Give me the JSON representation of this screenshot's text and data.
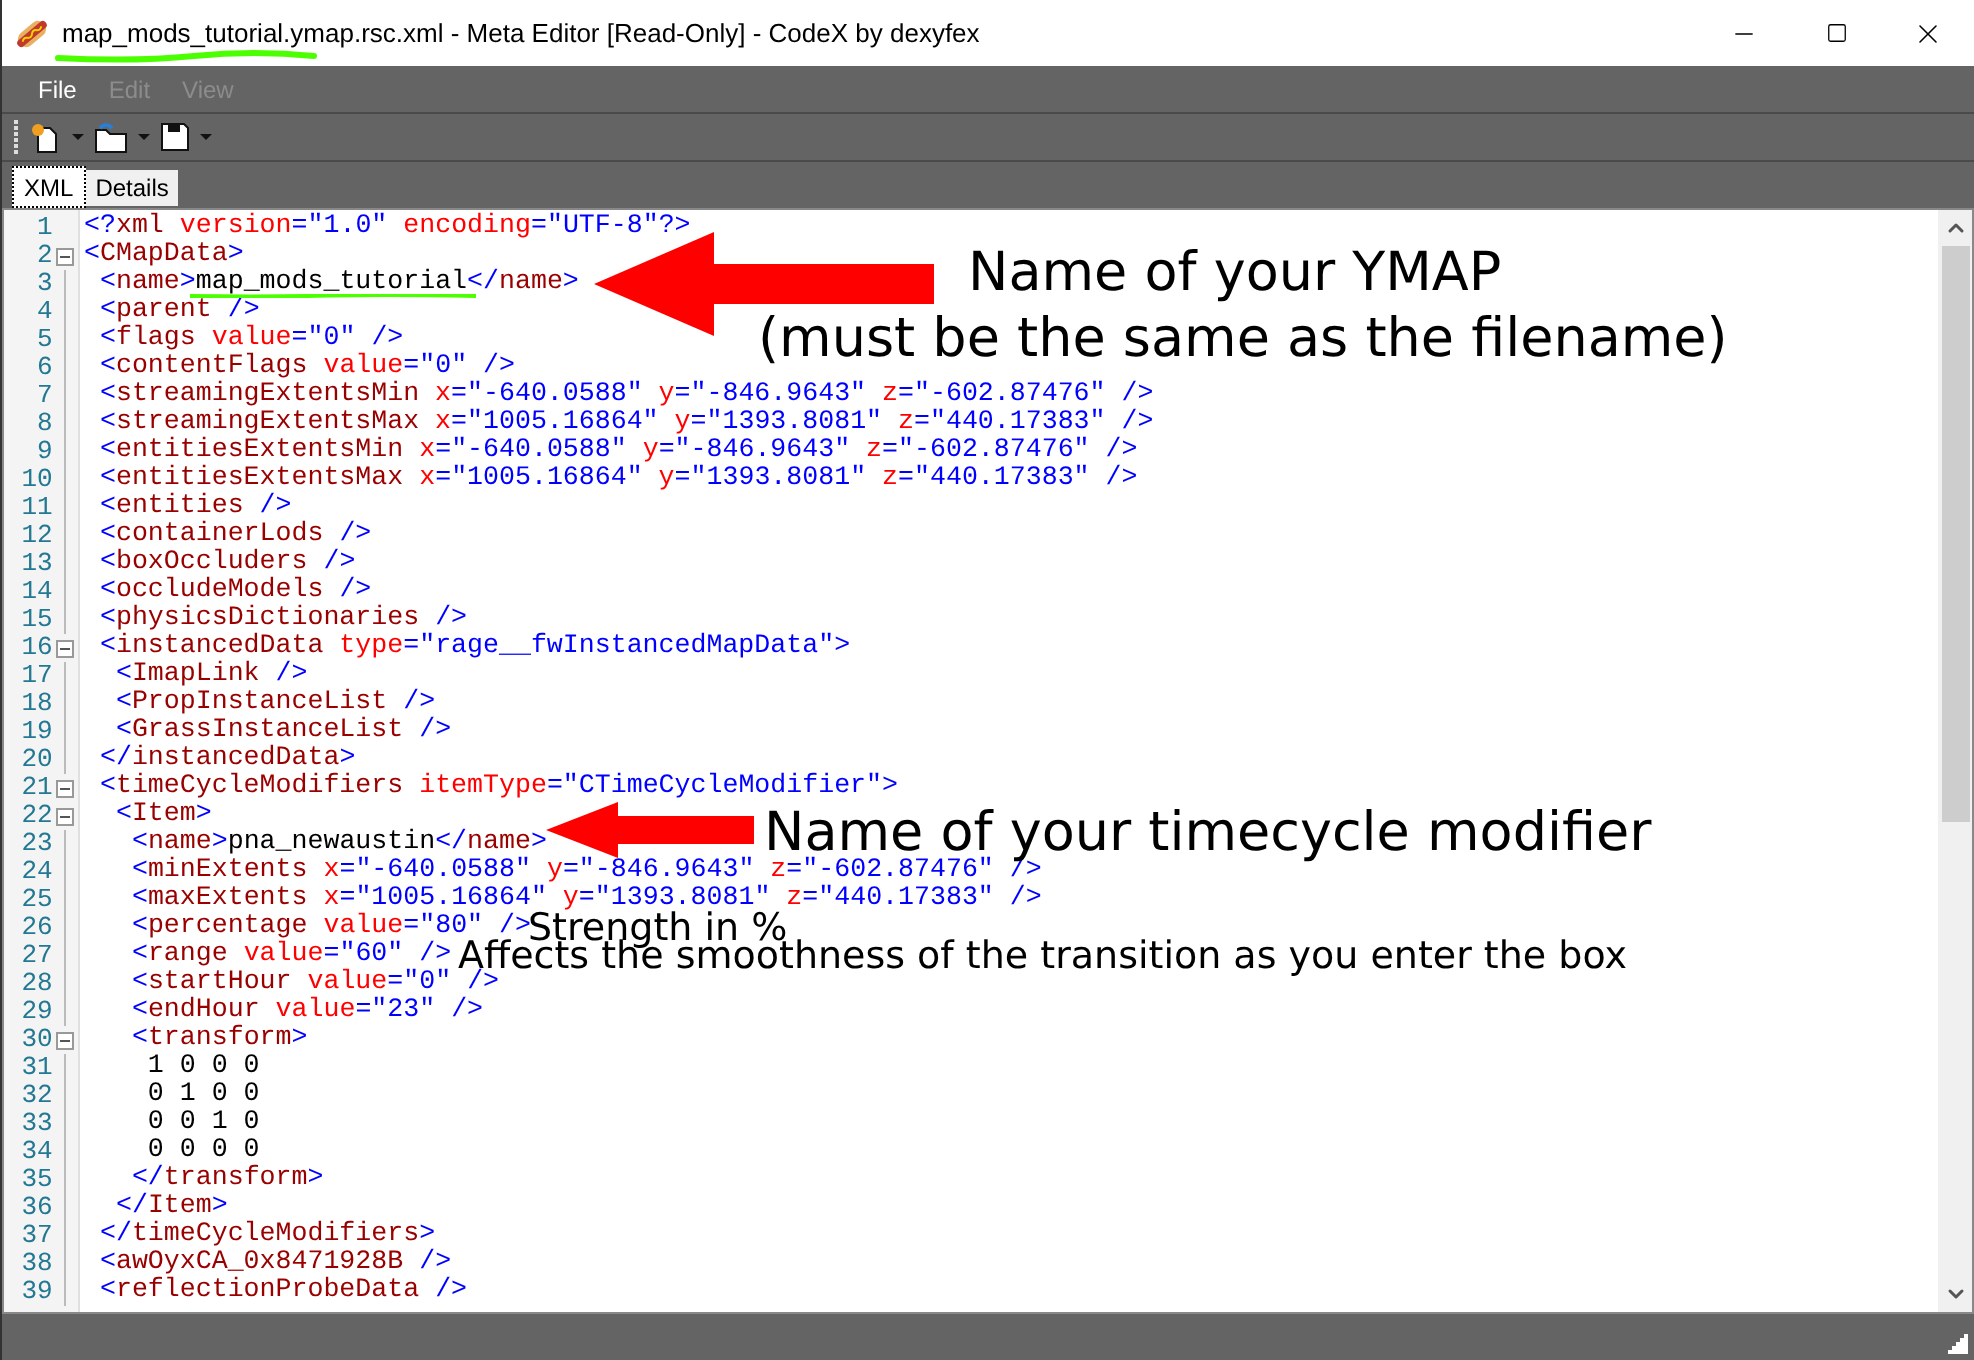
{
  "window": {
    "title": "map_mods_tutorial.ymap.rsc.xml - Meta Editor [Read-Only] - CodeX by dexyfex"
  },
  "menu": [
    {
      "label": "File",
      "disabled": false
    },
    {
      "label": "Edit",
      "disabled": true
    },
    {
      "label": "View",
      "disabled": true
    }
  ],
  "tabs": [
    {
      "label": "XML",
      "selected": true
    },
    {
      "label": "Details",
      "selected": false
    }
  ],
  "editor": {
    "lines": [
      {
        "number": "1",
        "text": "<?xml version=\"1.0\" encoding=\"UTF-8\"?>",
        "fold": false
      },
      {
        "number": "2",
        "text": "<CMapData>",
        "fold": true
      },
      {
        "number": "3",
        "text": " <name>map_mods_tutorial</name>",
        "fold": false
      },
      {
        "number": "4",
        "text": " <parent />",
        "fold": false
      },
      {
        "number": "5",
        "text": " <flags value=\"0\" />",
        "fold": false
      },
      {
        "number": "6",
        "text": " <contentFlags value=\"0\" />",
        "fold": false
      },
      {
        "number": "7",
        "text": " <streamingExtentsMin x=\"-640.0588\" y=\"-846.9643\" z=\"-602.87476\" />",
        "fold": false
      },
      {
        "number": "8",
        "text": " <streamingExtentsMax x=\"1005.16864\" y=\"1393.8081\" z=\"440.17383\" />",
        "fold": false
      },
      {
        "number": "9",
        "text": " <entitiesExtentsMin x=\"-640.0588\" y=\"-846.9643\" z=\"-602.87476\" />",
        "fold": false
      },
      {
        "number": "10",
        "text": " <entitiesExtentsMax x=\"1005.16864\" y=\"1393.8081\" z=\"440.17383\" />",
        "fold": false
      },
      {
        "number": "11",
        "text": " <entities />",
        "fold": false
      },
      {
        "number": "12",
        "text": " <containerLods />",
        "fold": false
      },
      {
        "number": "13",
        "text": " <boxOccluders />",
        "fold": false
      },
      {
        "number": "14",
        "text": " <occludeModels />",
        "fold": false
      },
      {
        "number": "15",
        "text": " <physicsDictionaries />",
        "fold": false
      },
      {
        "number": "16",
        "text": " <instancedData type=\"rage__fwInstancedMapData\">",
        "fold": true
      },
      {
        "number": "17",
        "text": "  <ImapLink />",
        "fold": false
      },
      {
        "number": "18",
        "text": "  <PropInstanceList />",
        "fold": false
      },
      {
        "number": "19",
        "text": "  <GrassInstanceList />",
        "fold": false
      },
      {
        "number": "20",
        "text": " </instancedData>",
        "fold": false
      },
      {
        "number": "21",
        "text": " <timeCycleModifiers itemType=\"CTimeCycleModifier\">",
        "fold": true
      },
      {
        "number": "22",
        "text": "  <Item>",
        "fold": true
      },
      {
        "number": "23",
        "text": "   <name>pna_newaustin</name>",
        "fold": false
      },
      {
        "number": "24",
        "text": "   <minExtents x=\"-640.0588\" y=\"-846.9643\" z=\"-602.87476\" />",
        "fold": false
      },
      {
        "number": "25",
        "text": "   <maxExtents x=\"1005.16864\" y=\"1393.8081\" z=\"440.17383\" />",
        "fold": false
      },
      {
        "number": "26",
        "text": "   <percentage value=\"80\" />",
        "fold": false
      },
      {
        "number": "27",
        "text": "   <range value=\"60\" />",
        "fold": false
      },
      {
        "number": "28",
        "text": "   <startHour value=\"0\" />",
        "fold": false
      },
      {
        "number": "29",
        "text": "   <endHour value=\"23\" />",
        "fold": false
      },
      {
        "number": "30",
        "text": "   <transform>",
        "fold": true
      },
      {
        "number": "31",
        "text": "    1 0 0 0",
        "fold": false
      },
      {
        "number": "32",
        "text": "    0 1 0 0",
        "fold": false
      },
      {
        "number": "33",
        "text": "    0 0 1 0",
        "fold": false
      },
      {
        "number": "34",
        "text": "    0 0 0 0",
        "fold": false
      },
      {
        "number": "35",
        "text": "   </transform>",
        "fold": false
      },
      {
        "number": "36",
        "text": "  </Item>",
        "fold": false
      },
      {
        "number": "37",
        "text": " </timeCycleModifiers>",
        "fold": false
      },
      {
        "number": "38",
        "text": " <awOyxCA_0x8471928B />",
        "fold": false
      },
      {
        "number": "39",
        "text": " <reflectionProbeData />",
        "fold": false
      }
    ]
  },
  "annotations": [
    {
      "kind": "arrow",
      "lines": [
        "Name of your YMAP",
        "(must be the same as the filename)"
      ]
    },
    {
      "kind": "arrow",
      "lines": [
        "Name of your timecycle modifier"
      ]
    },
    {
      "kind": "note",
      "lines": [
        "Strength in %"
      ]
    },
    {
      "kind": "note",
      "lines": [
        "Affects the smoothness of the transition as you enter the box"
      ]
    }
  ]
}
